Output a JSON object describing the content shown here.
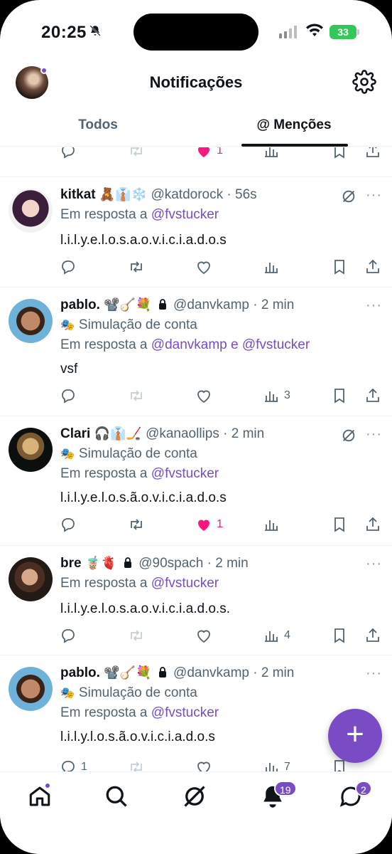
{
  "status": {
    "time": "20:25",
    "battery": "33"
  },
  "header": {
    "title": "Notificações"
  },
  "tabs": {
    "all": "Todos",
    "mentions": "@ Menções"
  },
  "partial_post": {
    "likes": "1"
  },
  "posts": [
    {
      "name": "kitkat",
      "emojis": "🧸👔❄️",
      "handle": "@katdorock",
      "time": "· 56s",
      "simulation": "",
      "reply_prefix": "Em resposta a",
      "reply_to": "@fvstucker",
      "text": "l.i.l.y.e.l.o.s.a.o.v.i.c.i.a.d.o.s",
      "views": ""
    },
    {
      "name": "pablo.",
      "emojis": "📽️🪕💐",
      "handle": "@danvkamp",
      "time": "· 2 min",
      "simulation": "Simulação de conta",
      "reply_prefix": "Em resposta a",
      "reply_to": "@danvkamp e @fvstucker",
      "text": "vsf",
      "views": "3"
    },
    {
      "name": "Clari",
      "emojis": "🎧👔🏒",
      "handle": "@kanaollips",
      "time": "· 2 min",
      "simulation": "Simulação de conta",
      "reply_prefix": "Em resposta a",
      "reply_to": "@fvstucker",
      "text": "l.i.l.y.e.l.o.s.ã.o.v.i.c.i.a.d.o.s",
      "likes": "1"
    },
    {
      "name": "bre",
      "emojis": "🧋🫀",
      "handle": "@90spach",
      "time": "· 2 min",
      "reply_prefix": "Em resposta a",
      "reply_to": "@fvstucker",
      "text": "l.i.l.y.e.l.o.s.a.o.v.i.c.i.a.d.o.s.",
      "views": "4"
    },
    {
      "name": "pablo.",
      "emojis": "📽️🪕💐",
      "handle": "@danvkamp",
      "time": "· 2 min",
      "simulation": "Simulação de conta",
      "reply_prefix": "Em resposta a",
      "reply_to": "@fvstucker",
      "text": "l.i.l.y.l.o.s.ã.o.v.i.c.i.a.d.o.s",
      "replies": "1",
      "views": "7"
    }
  ],
  "fab": {
    "label": "+"
  },
  "nav": {
    "notif_badge": "19",
    "msg_badge": "2"
  },
  "colors": {
    "accent": "#794bc4",
    "like": "#f91880",
    "muted": "#536471"
  }
}
